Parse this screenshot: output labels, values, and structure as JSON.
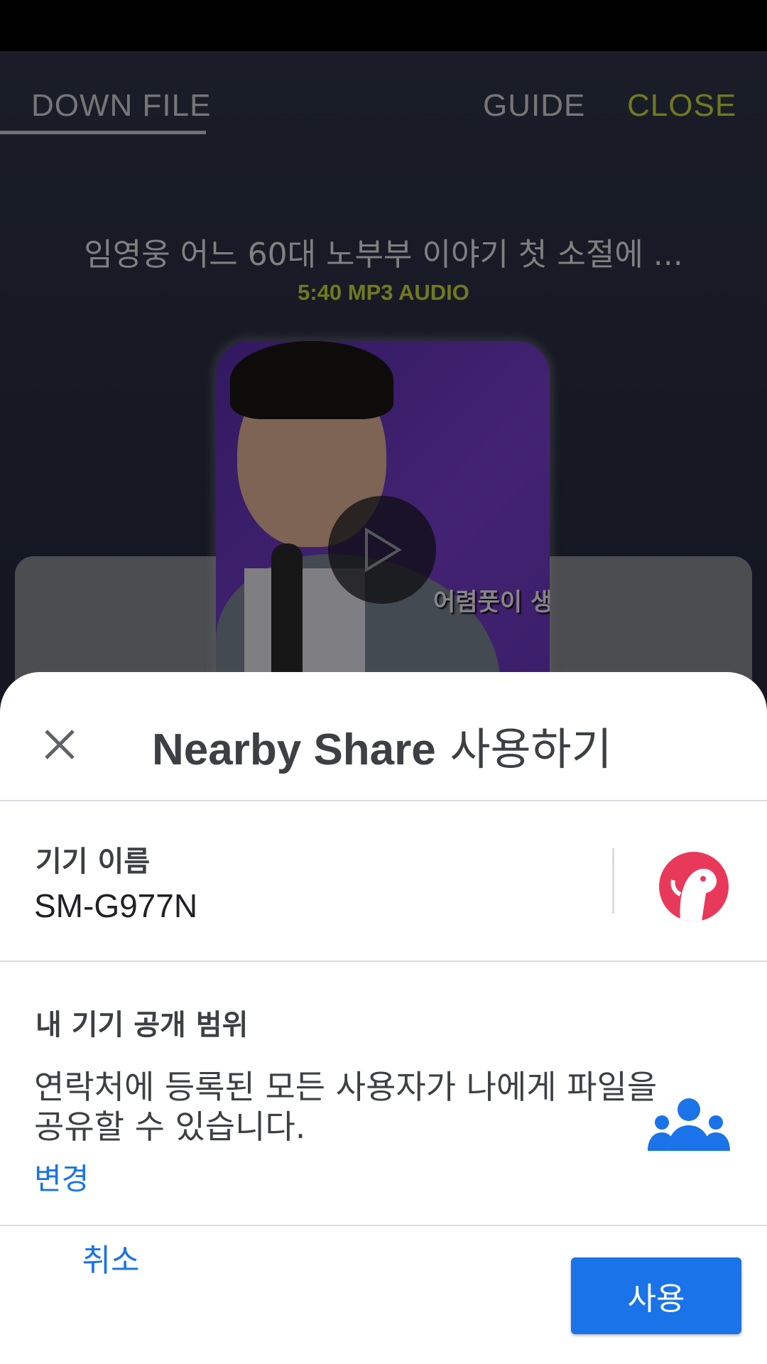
{
  "background_app": {
    "nav": {
      "down_file": "DOWN FILE",
      "guide": "GUIDE",
      "close": "CLOSE"
    },
    "song": {
      "title": "임영웅 어느 60대 노부부 이야기 첫 소절에 ...",
      "meta": "5:40 MP3 AUDIO",
      "album_caption": "어렴풋이 생"
    }
  },
  "sheet": {
    "title_brand": "Nearby Share",
    "title_suffix": " 사용하기",
    "device_name": {
      "label": "기기 이름",
      "value": "SM-G977N"
    },
    "visibility": {
      "label": "내 기기 공개 범위",
      "description": "연락처에 등록된 모든 사용자가 나에게 파일을 공유할 수 있습니다.",
      "change_link": "변경"
    },
    "buttons": {
      "cancel": "취소",
      "use": "사용"
    }
  },
  "colors": {
    "accent": "#1a73e8",
    "avatar": "#e9395a",
    "nav_close": "#cddc39"
  }
}
